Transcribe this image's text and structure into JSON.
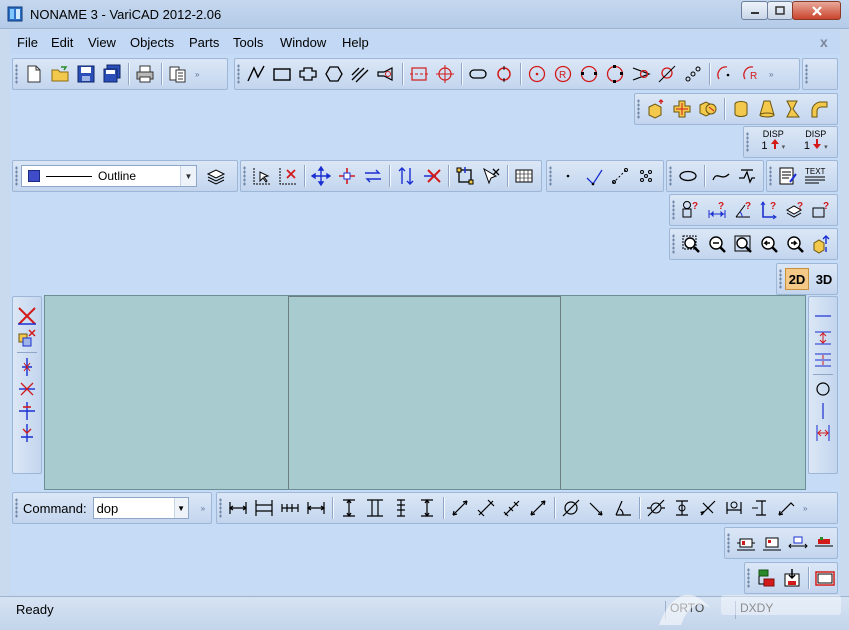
{
  "window": {
    "title": "NONAME 3 - VariCAD 2012-2.06",
    "mdi_close": "x"
  },
  "menu": [
    "File",
    "Edit",
    "View",
    "Objects",
    "Parts",
    "Tools",
    "Window",
    "Help"
  ],
  "properties_toolbar": {
    "linetype_color": "#3f4cc9",
    "linetype_label": "Outline"
  },
  "disp_buttons": [
    {
      "label": "DISP",
      "value": "1"
    },
    {
      "label": "DISP",
      "value": "1"
    }
  ],
  "text_tool_label": "TEXT",
  "view_mode": {
    "two_d": "2D",
    "three_d": "3D"
  },
  "command": {
    "label": "Command:",
    "value": "dop"
  },
  "status": {
    "text": "Ready",
    "field_ortho": "ORTO",
    "field_coords": "DXDY"
  },
  "accent_colors": {
    "red": "#d21a1a",
    "blue": "#1a2fd2",
    "canvas": "#a7cbcf"
  }
}
